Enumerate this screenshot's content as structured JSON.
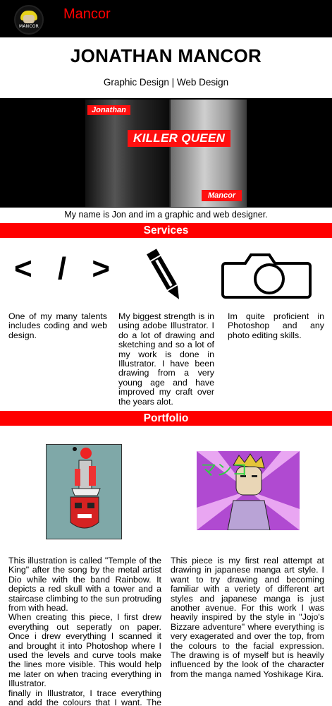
{
  "nav": {
    "logo_text": "MANCOR",
    "brand": "Mancor"
  },
  "header": {
    "title": "JONATHAN MANCOR",
    "subtitle": "Graphic Design | Web Design"
  },
  "hero": {
    "tag_top": "Jonathan",
    "tag_center": "KILLER QUEEN",
    "tag_bottom": "Mancor"
  },
  "intro": "My name is Jon and im a graphic and web designer.",
  "services": {
    "heading": "Services",
    "code_glyph": "< / >",
    "items": [
      {
        "icon": "code-icon",
        "text": "One of my many talents includes coding and web design."
      },
      {
        "icon": "pencil-icon",
        "text": "My biggest strength is in using adobe Illustrator. I do a lot of drawing and sketching and so a lot of my work is done in Illustrator. I have been drawing from a very young age and have improved my craft over the years alot."
      },
      {
        "icon": "camera-icon",
        "text": "Im quite proficient in Photoshop and any photo editing skills."
      }
    ]
  },
  "portfolio": {
    "heading": "Portfolio",
    "art2_text": "マンコ",
    "item1_paragraphs": [
      "This illustration is called \"Temple of the King\" after the song by the metal artist Dio while with the band Rainbow. It depicts a red skull with a tower and a staircase climbing to the sun protruding from with head.",
      "When creating this piece, I first drew everything out seperatly on paper. Once i drew everything I scanned it and brought it into Photoshop where I used the levels and curve tools make the lines more visible. This would help me later on when tracing everything in Illustrator.",
      "finally in Illustrator, I trace everything and add the colours that I want. The trick here is to get the stacking order of each layer correctly and grouping elements together"
    ],
    "item2_paragraphs": [
      "This piece is my first real attempt at drawing in japanese manga art style. I want to try drawing and becoming familiar with a veriety of different art styles and japanese manga is just another avenue. For this work I was heavily inspired by the style in \"Jojo's Bizzare adventure\" where everything is very exagerated and over the top, from the colours to the facial expression. The drawing is of myself but is heavily influenced by the look of the character from the manga named Yoshikage Kira."
    ]
  },
  "colors": {
    "accent": "#ff0000",
    "nav_bg": "#000000",
    "page_bg": "#ffffff"
  }
}
